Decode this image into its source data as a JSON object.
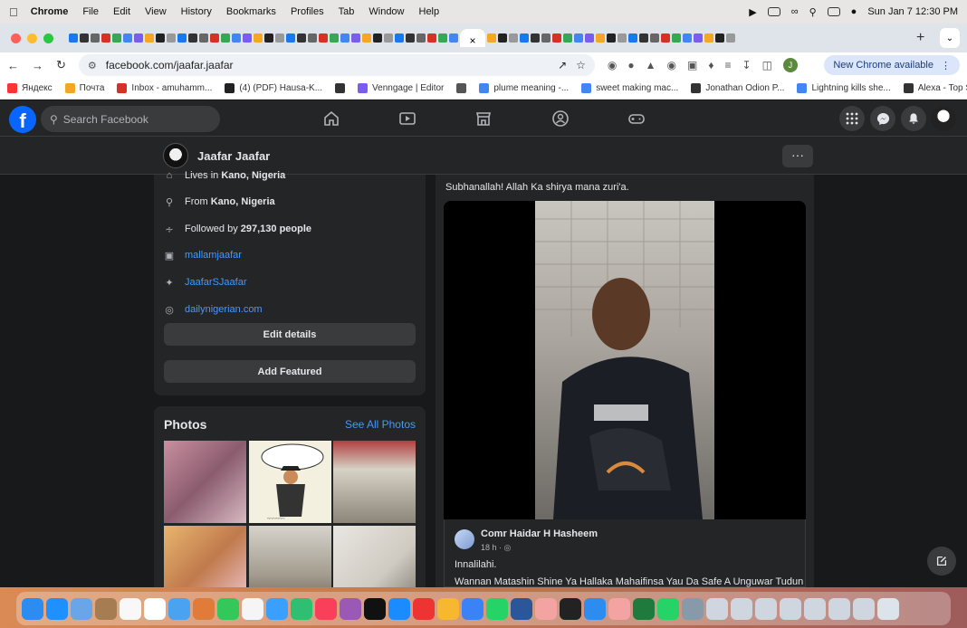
{
  "menubar": {
    "app": "Chrome",
    "items": [
      "File",
      "Edit",
      "View",
      "History",
      "Bookmarks",
      "Profiles",
      "Tab",
      "Window",
      "Help"
    ],
    "datetime": "Sun Jan 7  12:30 PM"
  },
  "toolbar": {
    "url": "facebook.com/jaafar.jaafar",
    "profile_initial": "J",
    "update_label": "New Chrome available"
  },
  "bookmarks": [
    {
      "label": "Яндекс",
      "color": "#f33"
    },
    {
      "label": "Почта",
      "color": "#f5a623"
    },
    {
      "label": "Inbox - amuhamm...",
      "color": "#d93025"
    },
    {
      "label": "(4) (PDF) Hausa-K...",
      "color": "#222"
    },
    {
      "label": "",
      "color": "#333"
    },
    {
      "label": "Venngage | Editor",
      "color": "#7a5cf0"
    },
    {
      "label": "",
      "color": "#555"
    },
    {
      "label": "plume meaning -...",
      "color": "#4285f4"
    },
    {
      "label": "sweet making mac...",
      "color": "#4285f4"
    },
    {
      "label": "Jonathan Odion P...",
      "color": "#333"
    },
    {
      "label": "Lightning kills she...",
      "color": "#4285f4"
    },
    {
      "label": "Alexa - Top Sites i...",
      "color": "#333"
    }
  ],
  "facebook": {
    "search_placeholder": "Search Facebook",
    "profile_name": "Jaafar Jaafar",
    "more": "···",
    "intro": {
      "lives_prefix": "Lives in ",
      "lives_place": "Kano, Nigeria",
      "from_prefix": "From ",
      "from_place": "Kano, Nigeria",
      "followed_prefix": "Followed by ",
      "followed_count": "297,130 people",
      "instagram": "mallamjaafar",
      "twitter": "JaafarSJaafar",
      "website": "dailynigerian.com",
      "edit_details": "Edit details",
      "add_featured": "Add Featured"
    },
    "photos": {
      "title": "Photos",
      "see_all": "See All Photos"
    },
    "post": {
      "caption": "Subhanallah! Allah Ka shirya mana zuri'a.",
      "shared_author": "Comr Haidar H Hasheem",
      "shared_time": "18 h ·",
      "shared_line1": "Innalilahi.",
      "shared_line2": "Wannan Matashin Shine Ya Hallaka Mahaifinsa Yau Da Safe A Unguwar Tudun"
    }
  },
  "colors": {
    "fb_blue": "#0866ff",
    "link": "#4599ff",
    "card": "#242526",
    "bg": "#18191a"
  }
}
